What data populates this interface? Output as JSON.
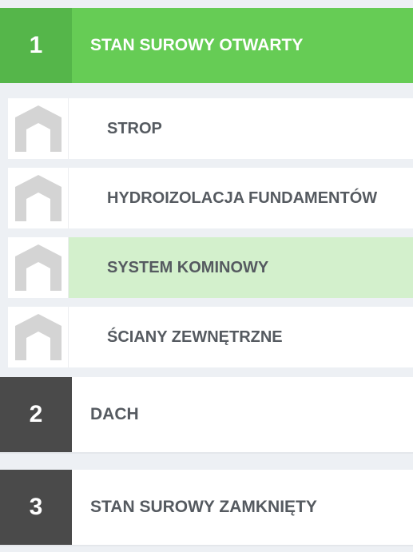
{
  "stages": [
    {
      "number": "1",
      "title": "STAN SUROWY OTWARTY",
      "state": "active",
      "items": [
        {
          "label": "STROP",
          "icon": "house-placeholder-icon",
          "selected": false
        },
        {
          "label": "HYDROIZOLACJA FUNDAMENTÓW",
          "icon": "house-placeholder-icon",
          "selected": false
        },
        {
          "label": "SYSTEM KOMINOWY",
          "icon": "house-placeholder-icon",
          "selected": true
        },
        {
          "label": "ŚCIANY ZEWNĘTRZNE",
          "icon": "house-placeholder-icon",
          "selected": false
        }
      ]
    },
    {
      "number": "2",
      "title": "DACH",
      "state": "inactive"
    },
    {
      "number": "3",
      "title": "STAN SUROWY ZAMKNIĘTY",
      "state": "inactive"
    }
  ],
  "colors": {
    "active_bar": "#66cc55",
    "active_number_box": "#55b64a",
    "inactive_number_box": "#4a4a4a",
    "selected_item_bg": "#d3f0cc",
    "label_text": "#555a60",
    "page_bg": "#edf0f4",
    "placeholder_icon": "#d4d4d4"
  }
}
